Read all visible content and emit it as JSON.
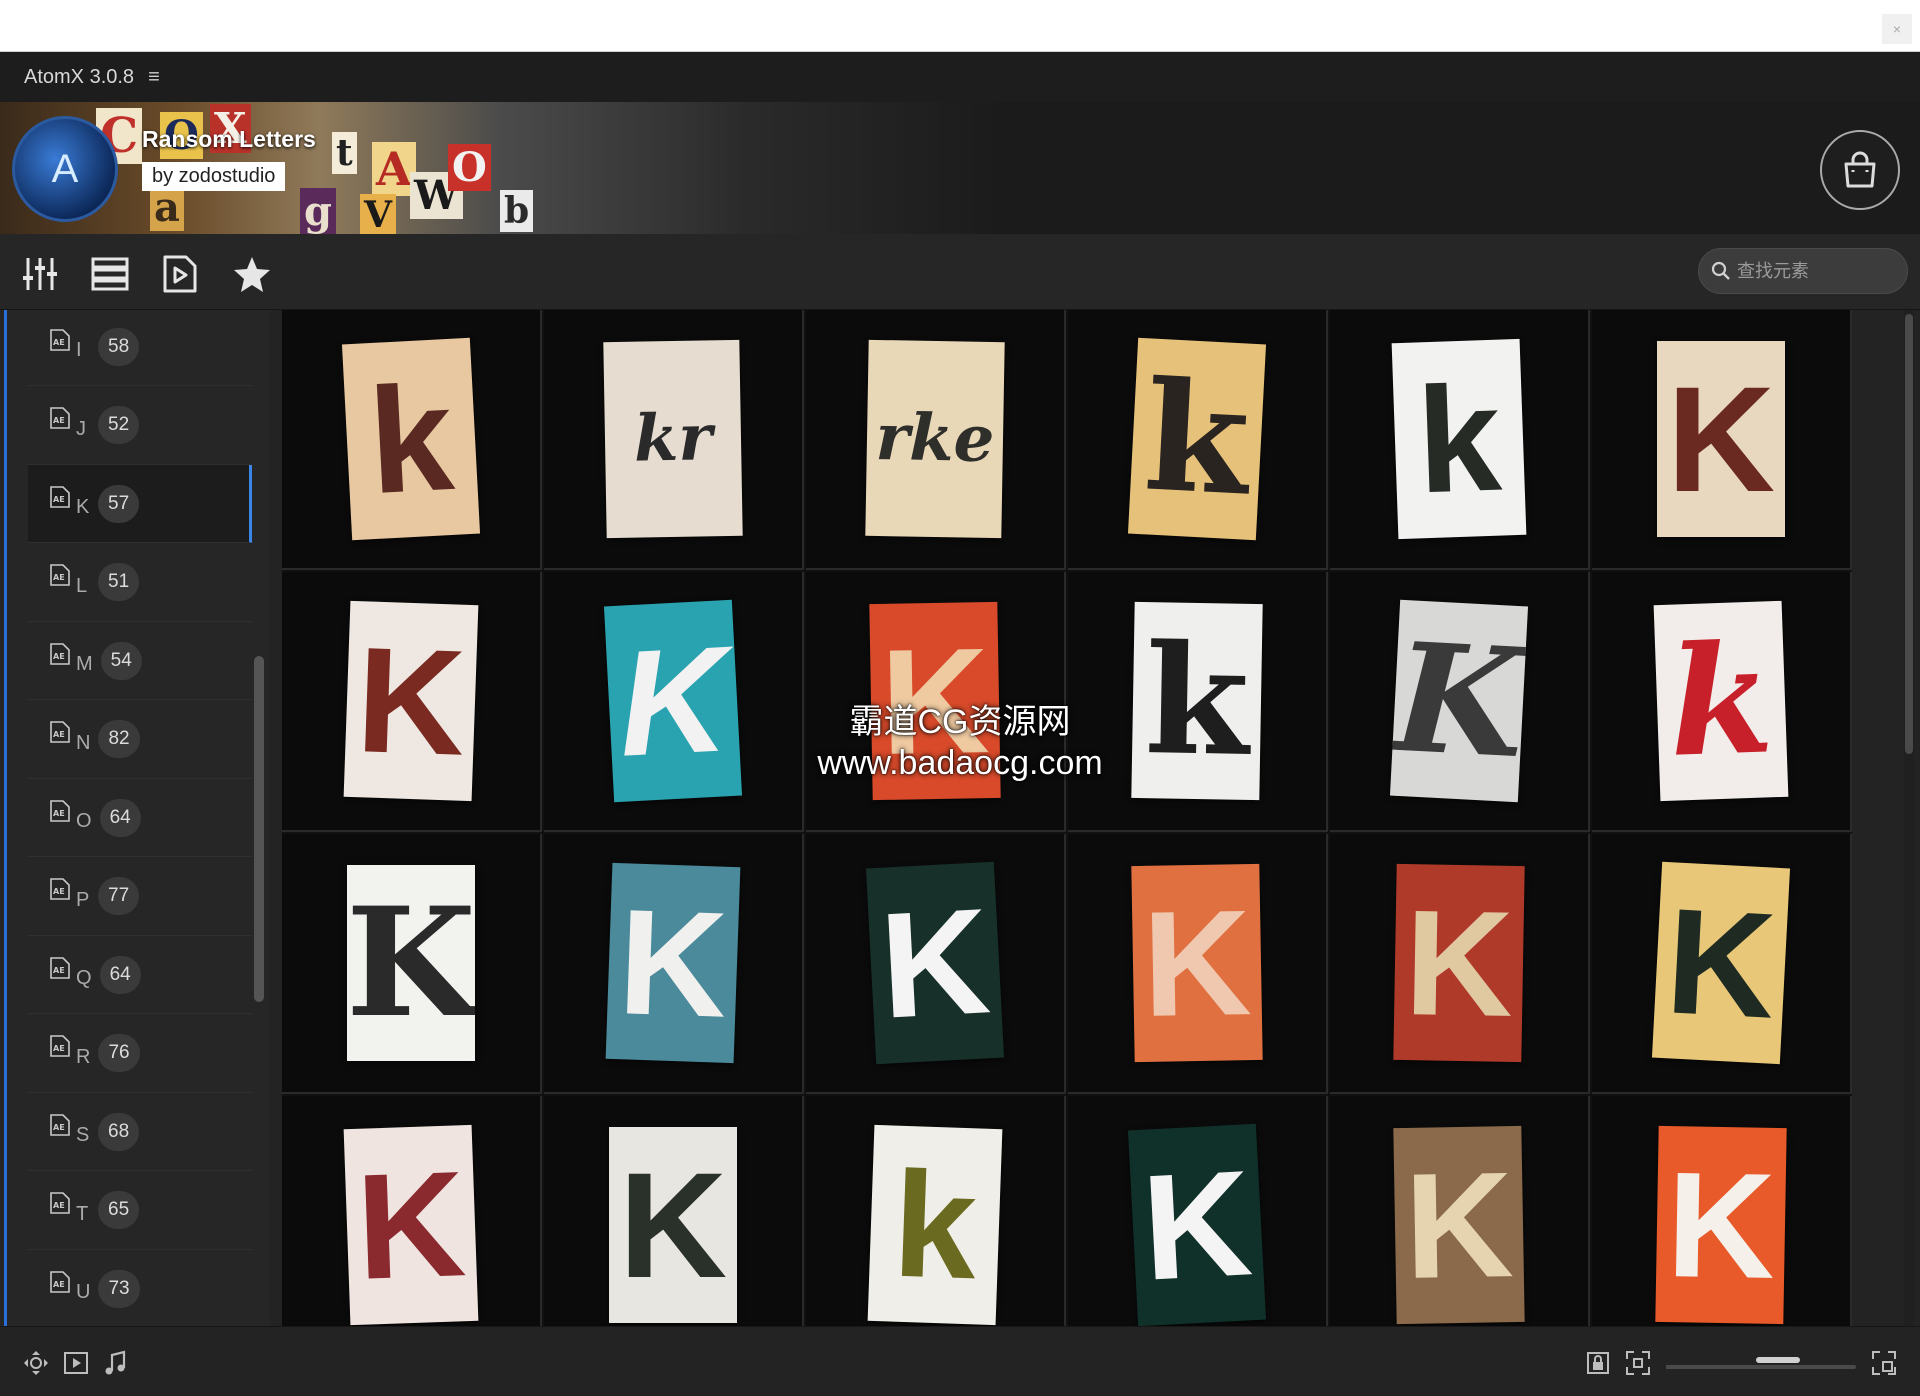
{
  "window": {
    "close_glyph": "×"
  },
  "app": {
    "title": "AtomX 3.0.8",
    "menu_glyph": "≡"
  },
  "banner": {
    "pack_title": "Ransom Letters",
    "pack_author": "by zodostudio",
    "logo_glyph": "A"
  },
  "toolbar": {
    "icons": [
      "sliders-icon",
      "list-icon",
      "play-file-icon",
      "star-icon"
    ],
    "search_placeholder": "查找元素"
  },
  "sidebar": {
    "items": [
      {
        "letter": "I",
        "count": "58",
        "active": false
      },
      {
        "letter": "J",
        "count": "52",
        "active": false
      },
      {
        "letter": "K",
        "count": "57",
        "active": true
      },
      {
        "letter": "L",
        "count": "51",
        "active": false
      },
      {
        "letter": "M",
        "count": "54",
        "active": false
      },
      {
        "letter": "N",
        "count": "82",
        "active": false
      },
      {
        "letter": "O",
        "count": "64",
        "active": false
      },
      {
        "letter": "P",
        "count": "77",
        "active": false
      },
      {
        "letter": "Q",
        "count": "64",
        "active": false
      },
      {
        "letter": "R",
        "count": "76",
        "active": false
      },
      {
        "letter": "S",
        "count": "68",
        "active": false
      },
      {
        "letter": "T",
        "count": "65",
        "active": false
      },
      {
        "letter": "U",
        "count": "73",
        "active": false
      }
    ]
  },
  "grid": {
    "items": [
      {
        "glyph": "k",
        "bg": "#e8c8a0",
        "fg": "#5a2a22",
        "font": "Liberation Sans",
        "italic": false
      },
      {
        "glyph": "kr",
        "bg": "#e6ddd0",
        "fg": "#2a2a2a",
        "font": "DejaVu Serif",
        "italic": true
      },
      {
        "glyph": "rke",
        "bg": "#e9d8b8",
        "fg": "#2e2e2a",
        "font": "DejaVu Serif",
        "italic": true
      },
      {
        "glyph": "k",
        "bg": "#e6c17a",
        "fg": "#2a2420",
        "font": "DejaVu Serif",
        "italic": false
      },
      {
        "glyph": "k",
        "bg": "#f2f2f0",
        "fg": "#262b26",
        "font": "Liberation Sans",
        "italic": false
      },
      {
        "glyph": "K",
        "bg": "#e8d8c0",
        "fg": "#6a2a22",
        "font": "Liberation Sans",
        "italic": false
      },
      {
        "glyph": "K",
        "bg": "#efe8e2",
        "fg": "#7a2a20",
        "font": "Liberation Sans",
        "italic": false
      },
      {
        "glyph": "K",
        "bg": "#2aa3b0",
        "fg": "#f2f2f2",
        "font": "Liberation Sans",
        "italic": true
      },
      {
        "glyph": "K",
        "bg": "#d84a2a",
        "fg": "#efc9a0",
        "font": "Liberation Sans",
        "italic": false
      },
      {
        "glyph": "k",
        "bg": "#efefed",
        "fg": "#1e1e1e",
        "font": "DejaVu Serif",
        "italic": false
      },
      {
        "glyph": "K",
        "bg": "#d8d8d6",
        "fg": "#3a3a3a",
        "font": "DejaVu Serif",
        "italic": true
      },
      {
        "glyph": "k",
        "bg": "#f2ecea",
        "fg": "#c8202a",
        "font": "DejaVu Serif",
        "italic": true
      },
      {
        "glyph": "K",
        "bg": "#f2f2ef",
        "fg": "#2a2a2a",
        "font": "DejaVu Serif",
        "italic": false
      },
      {
        "glyph": "K",
        "bg": "#4a8a9a",
        "fg": "#f0f0ee",
        "font": "Liberation Sans",
        "italic": false
      },
      {
        "glyph": "K",
        "bg": "#18302a",
        "fg": "#f4f4f4",
        "font": "Liberation Sans",
        "italic": false
      },
      {
        "glyph": "K",
        "bg": "#e07040",
        "fg": "#f0c8b0",
        "font": "Liberation Sans",
        "italic": false
      },
      {
        "glyph": "K",
        "bg": "#b03a2a",
        "fg": "#e0c8a0",
        "font": "Liberation Sans",
        "italic": false
      },
      {
        "glyph": "K",
        "bg": "#e8c878",
        "fg": "#1e2a22",
        "font": "Liberation Sans",
        "italic": false
      },
      {
        "glyph": "K",
        "bg": "#f0e4e0",
        "fg": "#8a2a2e",
        "font": "Liberation Sans",
        "italic": false
      },
      {
        "glyph": "K",
        "bg": "#e8e6e0",
        "fg": "#2a302a",
        "font": "Liberation Sans",
        "italic": false
      },
      {
        "glyph": "k",
        "bg": "#f0eee8",
        "fg": "#6a6a20",
        "font": "Liberation Sans",
        "italic": false
      },
      {
        "glyph": "K",
        "bg": "#10302a",
        "fg": "#f4f4f4",
        "font": "Liberation Sans",
        "italic": false
      },
      {
        "glyph": "K",
        "bg": "#8a6a4a",
        "fg": "#e6d4b0",
        "font": "Liberation Sans",
        "italic": false
      },
      {
        "glyph": "K",
        "bg": "#e85a2a",
        "fg": "#f6f0ea",
        "font": "Liberation Sans",
        "italic": false
      }
    ]
  },
  "watermark": {
    "line1": "霸道CG资源网",
    "line2": "www.badaocg.com"
  },
  "bottombar": {
    "left_icons": [
      "move-icon",
      "video-icon",
      "music-icon"
    ],
    "right_icons": [
      "lock-icon",
      "fit-icon",
      "fullscreen-icon"
    ],
    "zoom_level": 0.5
  }
}
